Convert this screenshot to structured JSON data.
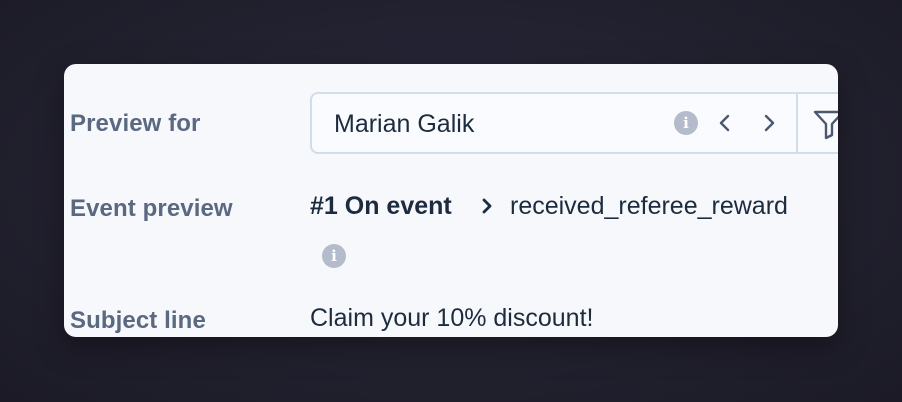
{
  "preview_for": {
    "label": "Preview for",
    "selected_user": "Marian Galik",
    "icons": [
      "info-icon",
      "chevron-left-icon",
      "chevron-right-icon",
      "filter-icon"
    ]
  },
  "event_preview": {
    "label": "Event preview",
    "prefix": "#1 On event",
    "event_name": "received_referee_reward",
    "icons": [
      "chevron-right-icon",
      "info-icon"
    ]
  },
  "subject_line": {
    "label": "Subject line",
    "value": "Claim your 10% discount!"
  },
  "colors": {
    "card_background": "#f6f8fc",
    "label_text": "#5a6880",
    "value_text": "#1d2b3e",
    "border": "#d2dceb",
    "info_icon": "#b4bccb"
  }
}
